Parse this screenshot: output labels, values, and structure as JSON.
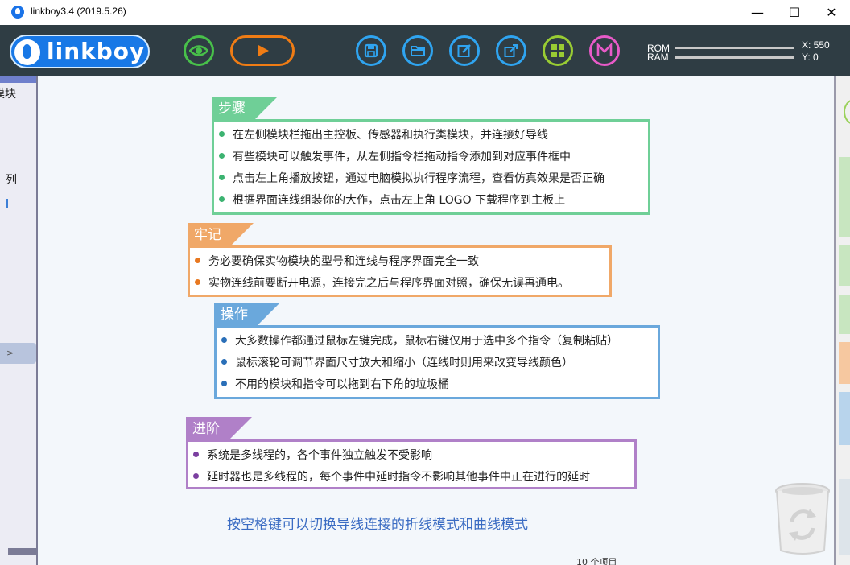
{
  "window": {
    "title": "linkboy3.4 (2019.5.26)",
    "minimize": "—",
    "maximize": "☐",
    "close": "✕"
  },
  "toolbar": {
    "logo_text": "linkboy",
    "rom_label": "ROM",
    "ram_label": "RAM",
    "x_coord": "X: 550",
    "y_coord": "Y: 0",
    "icons": [
      "eye-icon",
      "play-icon",
      "save-icon",
      "folder-icon",
      "edit-icon",
      "export-icon",
      "grid-icon",
      "m-icon"
    ]
  },
  "left_panel": {
    "item1": "模块",
    "item2": "列",
    "arrow": ">"
  },
  "cards": {
    "steps": {
      "title": "步骤",
      "color": "#6fcf97",
      "bullet_color": "#3cb371",
      "items": [
        "在左侧模块栏拖出主控板、传感器和执行类模块，并连接好导线",
        "有些模块可以触发事件，从左侧指令栏拖动指令添加到对应事件框中",
        "点击左上角播放按钮，通过电脑模拟执行程序流程，查看仿真效果是否正确",
        "根据界面连线组装你的大作，点击左上角 LOGO 下载程序到主板上"
      ]
    },
    "remember": {
      "title": "牢记",
      "color": "#f0a868",
      "bullet_color": "#e87820",
      "items": [
        "务必要确保实物模块的型号和连线与程序界面完全一致",
        "实物连线前要断开电源，连接完之后与程序界面对照，确保无误再通电。"
      ]
    },
    "operation": {
      "title": "操作",
      "color": "#6aa8dc",
      "bullet_color": "#2a6fb8",
      "items": [
        "大多数操作都通过鼠标左键完成，鼠标右键仅用于选中多个指令（复制粘贴）",
        "鼠标滚轮可调节界面尺寸放大和缩小（连线时则用来改变导线颜色）",
        "不用的模块和指令可以拖到右下角的垃圾桶"
      ]
    },
    "advanced": {
      "title": "进阶",
      "color": "#b080c8",
      "bullet_color": "#7b3fa0",
      "items": [
        "系统是多线程的，各个事件独立触发不受影响",
        "延时器也是多线程的，每个事件中延时指令不影响其他事件中正在进行的延时"
      ]
    }
  },
  "hint": "按空格键可以切换导线连接的折线模式和曲线模式",
  "status": "10 个项目"
}
